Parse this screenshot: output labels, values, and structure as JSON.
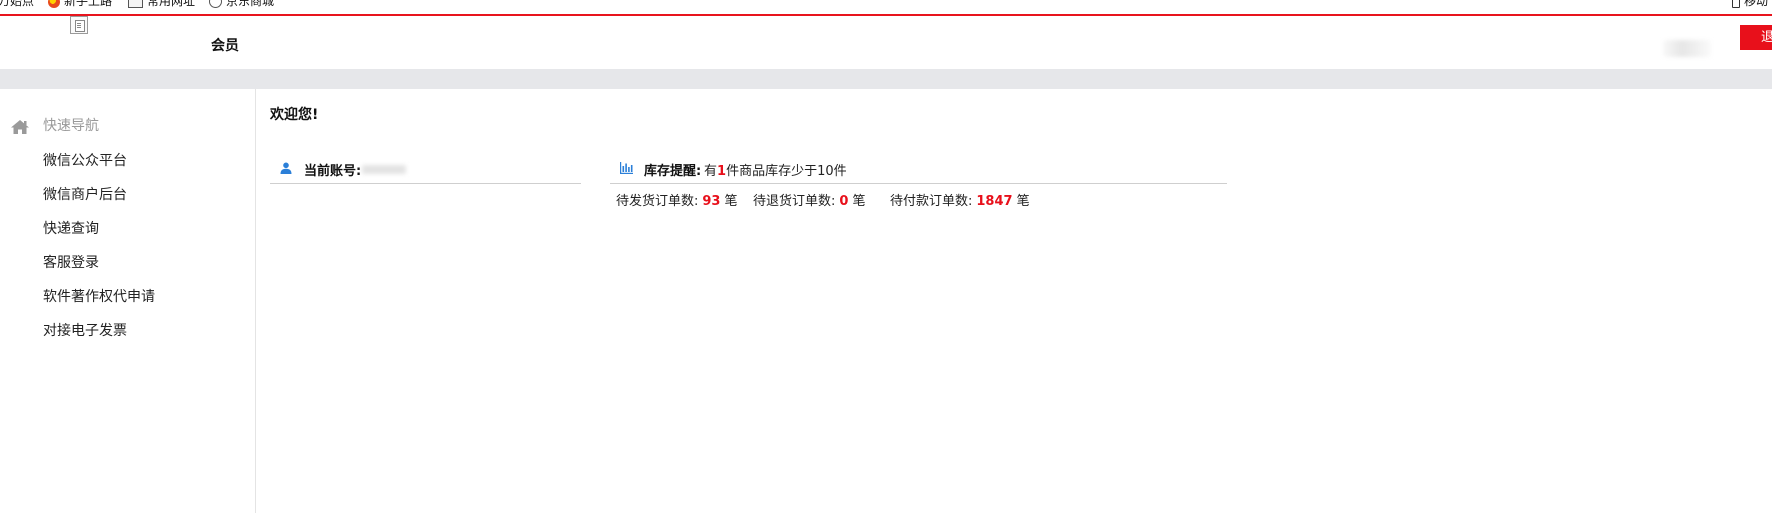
{
  "bookmarks": [
    {
      "label": "万始点",
      "icon": "none"
    },
    {
      "label": "新手上路",
      "icon": "firefox-icon"
    },
    {
      "label": "常用网址",
      "icon": "folder-icon"
    },
    {
      "label": "京东商城",
      "icon": "globe-icon"
    },
    {
      "label": "移动",
      "icon": "mobile-icon"
    }
  ],
  "header": {
    "title": "会员",
    "logout_label": "退出"
  },
  "sidebar": {
    "section_label": "快速导航",
    "items": [
      {
        "label": "微信公众平台"
      },
      {
        "label": "微信商户后台"
      },
      {
        "label": "快递查询"
      },
      {
        "label": "客服登录"
      },
      {
        "label": "软件著作权代申请"
      },
      {
        "label": "对接电子发票"
      }
    ]
  },
  "main": {
    "welcome": "欢迎您!",
    "account": {
      "label": "当前账号:"
    },
    "stock": {
      "label": "库存提醒:",
      "prefix": "有",
      "count": "1",
      "suffix": "件商品库存少于10件"
    },
    "stats": [
      {
        "label": "待发货订单数:",
        "value": "93",
        "unit": "笔"
      },
      {
        "label": "待退货订单数:",
        "value": "0",
        "unit": "笔"
      },
      {
        "label": "待付款订单数:",
        "value": "1847",
        "unit": "笔"
      }
    ]
  },
  "colors": {
    "accent": "#e8101b",
    "sidebar_icon": "#999999",
    "panel_icon": "#2b7fd8",
    "grey_bar": "#e6e7ea"
  }
}
